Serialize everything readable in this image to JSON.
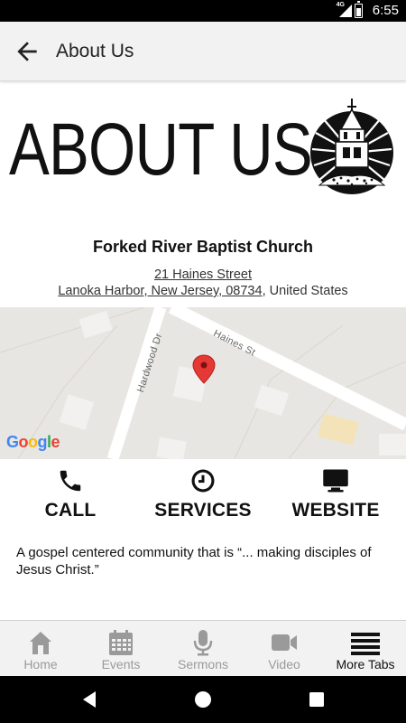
{
  "status_bar": {
    "time": "6:55",
    "network": "4G"
  },
  "app_bar": {
    "title": "About Us",
    "back_icon": "arrow-back-icon"
  },
  "banner": {
    "headline": "ABOUT US",
    "logo_icon": "church-steeple-logo"
  },
  "church": {
    "name": "Forked River Baptist Church",
    "address_line1": "21 Haines Street",
    "address_line2_link": "Lanoka Harbor, New Jersey, 08734",
    "address_line2_suffix": ", United States"
  },
  "map": {
    "streets": [
      "Haines St",
      "Hardwood Dr"
    ],
    "provider": "Google",
    "pin_color": "#e53935"
  },
  "actions": [
    {
      "label": "CALL",
      "icon": "phone-icon"
    },
    {
      "label": "SERVICES",
      "icon": "clock-icon"
    },
    {
      "label": "WEBSITE",
      "icon": "monitor-icon"
    }
  ],
  "description": "A gospel centered community that is “... making disciples of Jesus Christ.”",
  "tabs": [
    {
      "label": "Home",
      "icon": "home-icon",
      "active": false
    },
    {
      "label": "Events",
      "icon": "calendar-icon",
      "active": false
    },
    {
      "label": "Sermons",
      "icon": "microphone-icon",
      "active": false
    },
    {
      "label": "Video",
      "icon": "video-camera-icon",
      "active": false
    },
    {
      "label": "More Tabs",
      "icon": "menu-lines-icon",
      "active": true
    }
  ],
  "colors": {
    "status_bar": "#000000",
    "app_bar": "#f2f2f2",
    "tab_inactive": "#9a9a9a",
    "tab_active": "#111111"
  }
}
